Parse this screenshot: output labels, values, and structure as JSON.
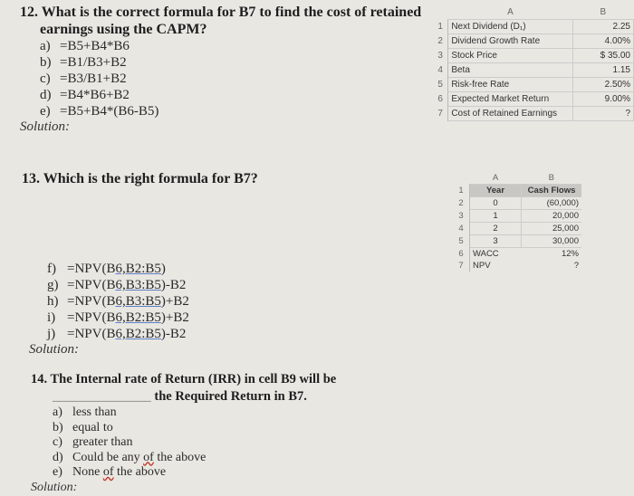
{
  "q12": {
    "title_line1": "12. What is the correct formula for B7 to find the cost of retained",
    "title_line2": "earnings using the CAPM?",
    "options": [
      {
        "label": "a)",
        "text": "=B5+B4*B6"
      },
      {
        "label": "b)",
        "text": "=B1/B3+B2"
      },
      {
        "label": "c)",
        "text": "=B3/B1+B2"
      },
      {
        "label": "d)",
        "text": "=B4*B6+B2"
      },
      {
        "label": "e)",
        "text": "=B5+B4*(B6-B5)"
      }
    ],
    "solution_label": "Solution:"
  },
  "sheet1": {
    "col_a": "A",
    "col_b": "B",
    "rows": [
      {
        "num": "1",
        "a": "Next Dividend (D₁)",
        "b": "2.25"
      },
      {
        "num": "2",
        "a": "Dividend Growth Rate",
        "b": "4.00%"
      },
      {
        "num": "3",
        "a": "Stock Price",
        "b": "$  35.00"
      },
      {
        "num": "4",
        "a": "Beta",
        "b": "1.15"
      },
      {
        "num": "5",
        "a": "Risk-free Rate",
        "b": "2.50%"
      },
      {
        "num": "6",
        "a": "Expected Market Return",
        "b": "9.00%"
      },
      {
        "num": "7",
        "a": "Cost of Retained Earnings",
        "b": "?"
      }
    ]
  },
  "q13": {
    "title": "13. Which is the right formula for B7?",
    "options": [
      {
        "label": "f)",
        "pre": "=NPV(B",
        "link": "6,B2:B5",
        "post": ")"
      },
      {
        "label": "g)",
        "pre": "=NPV(B",
        "link": "6,B3:B5",
        "post": ")-B2"
      },
      {
        "label": "h)",
        "pre": "=NPV(B",
        "link": "6,B3:B5",
        "post": ")+B2"
      },
      {
        "label": "i)",
        "pre": "=NPV(B",
        "link": "6,B2:B5",
        "post": ")+B2"
      },
      {
        "label": "j)",
        "pre": "=NPV(B",
        "link": "6,B2:B5",
        "post": ")-B2"
      }
    ],
    "solution_label": "Solution:"
  },
  "sheet2": {
    "col_a": "A",
    "col_b": "B",
    "rows": [
      {
        "num": "1",
        "a": "Year",
        "b": "Cash Flows"
      },
      {
        "num": "2",
        "a": "0",
        "b": "(60,000)"
      },
      {
        "num": "3",
        "a": "1",
        "b": "20,000"
      },
      {
        "num": "4",
        "a": "2",
        "b": "25,000"
      },
      {
        "num": "5",
        "a": "3",
        "b": "30,000"
      },
      {
        "num": "6",
        "a": "WACC",
        "b": "12%"
      },
      {
        "num": "7",
        "a": "NPV",
        "b": "?"
      }
    ]
  },
  "q14": {
    "title_line1": "14. The Internal rate of Return (IRR) in cell B9 will be",
    "blank": "_______________",
    "title_line2": " the Required Return in B7.",
    "options": [
      {
        "label": "a)",
        "text": "less than"
      },
      {
        "label": "b)",
        "text": "equal to"
      },
      {
        "label": "c)",
        "text": "greater than"
      },
      {
        "label": "d)",
        "pre": "Could be any ",
        "squig": "of",
        "post": " the above"
      },
      {
        "label": "e)",
        "pre": "None ",
        "squig": "of",
        "post": " the above"
      }
    ],
    "solution_label": "Solution:"
  }
}
